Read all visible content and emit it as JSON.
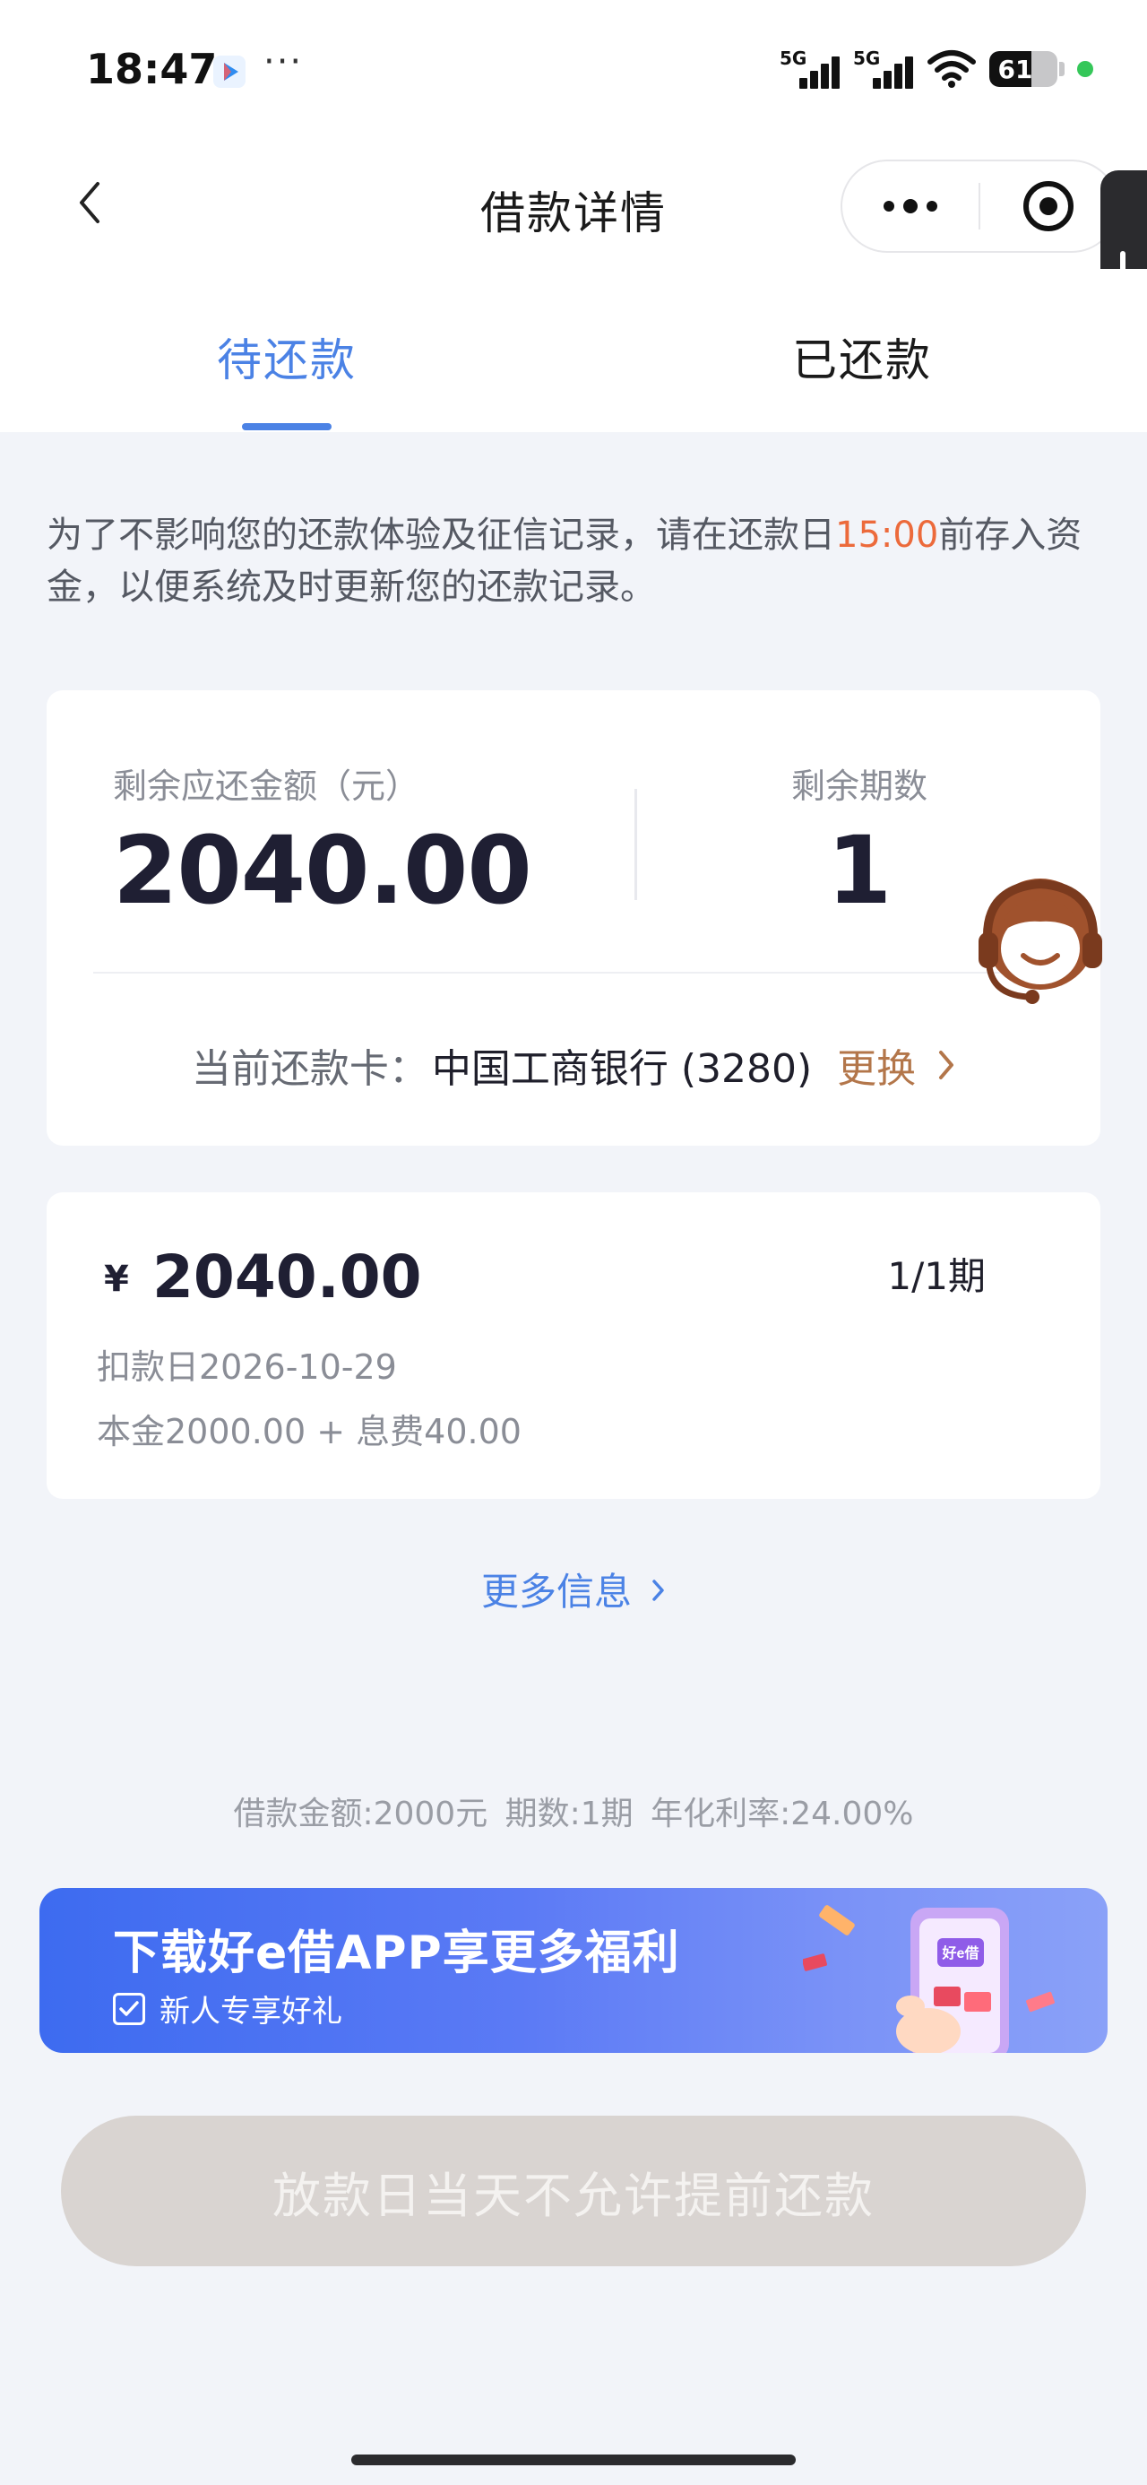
{
  "status_bar": {
    "time": "18:47",
    "dots": "···",
    "network_1": "5G",
    "network_2": "5G",
    "battery": "61",
    "app_icon": "video-app-icon",
    "wifi_icon": "wifi-icon"
  },
  "nav": {
    "title": "借款详情",
    "back_icon": "chevron-left-icon",
    "more_icon": "more-dots-icon",
    "close_icon": "target-close-icon"
  },
  "tabs": [
    {
      "label": "待还款",
      "active": true
    },
    {
      "label": "已还款",
      "active": false
    }
  ],
  "notice": {
    "before": "为了不影响您的还款体验及征信记录，请在还款日",
    "highlight": "15:00",
    "after": "前存入资金，以便系统及时更新您的还款记录。"
  },
  "summary": {
    "remaining_amount_label": "剩余应还金额（元）",
    "remaining_amount": "2040.00",
    "remaining_periods_label": "剩余期数",
    "remaining_periods": "1",
    "card_label": "当前还款卡：",
    "card_value": "中国工商银行 (3280)",
    "change_label": "更换"
  },
  "installment": {
    "currency": "¥",
    "amount": "2040.00",
    "period": "1/1期",
    "deduct_date": "扣款日2026-10-29",
    "breakdown": "本金2000.00 + 息费40.00"
  },
  "more_info": "更多信息",
  "loan_summary": "借款金额:2000元   期数:1期   年化利率:24.00%",
  "banner": {
    "title": "下载好e借APP享更多福利",
    "subtitle": "新人专享好礼",
    "phone_label": "好e借"
  },
  "repay_button": "放款日当天不允许提前还款",
  "colors": {
    "accent": "#4b82e5",
    "highlight": "#ec6a3b",
    "change": "#b3764a",
    "background": "#f2f4f9"
  }
}
